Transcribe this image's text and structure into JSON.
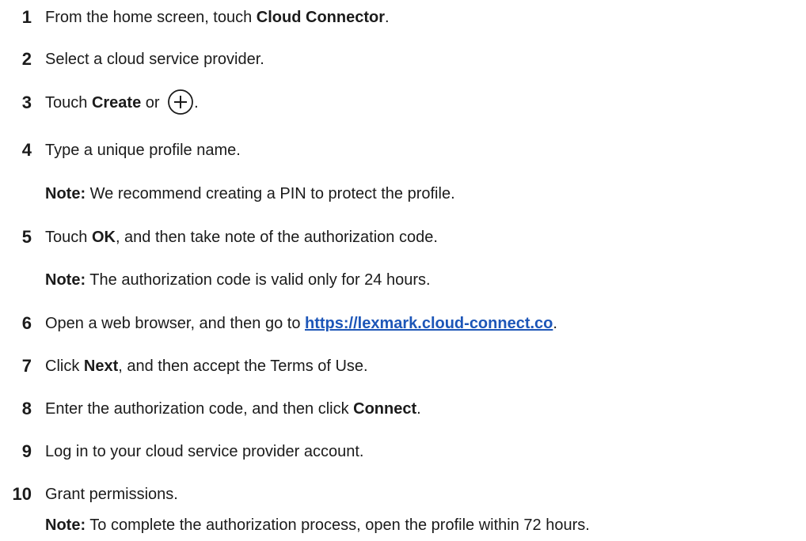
{
  "steps": [
    {
      "num": "1",
      "pre": "From the home screen, touch ",
      "bold": "Cloud Connector",
      "post": "."
    },
    {
      "num": "2",
      "text": "Select a cloud service provider."
    },
    {
      "num": "3",
      "pre": "Touch ",
      "bold": "Create",
      "mid": " or ",
      "post": ".",
      "icon": "plus-circle-icon"
    },
    {
      "num": "4",
      "text": "Type a unique profile name."
    },
    {
      "note": true,
      "label": "Note:",
      "text": " We recommend creating a PIN to protect the profile."
    },
    {
      "num": "5",
      "pre": "Touch ",
      "bold": "OK",
      "post": ", and then take note of the authorization code."
    },
    {
      "note": true,
      "label": "Note:",
      "text": " The authorization code is valid only for 24 hours."
    },
    {
      "num": "6",
      "pre": "Open a web browser, and then go to ",
      "link": "https://lexmark.cloud-connect.co",
      "post": "."
    },
    {
      "num": "7",
      "pre": "Click ",
      "bold": "Next",
      "post": ", and then accept the Terms of Use."
    },
    {
      "num": "8",
      "pre": "Enter the authorization code, and then click ",
      "bold": "Connect",
      "post": "."
    },
    {
      "num": "9",
      "text": "Log in to your cloud service provider account."
    },
    {
      "num": "10",
      "text": "Grant permissions."
    },
    {
      "note": true,
      "label": "Note:",
      "text": " To complete the authorization process, open the profile within 72 hours."
    }
  ],
  "colors": {
    "text": "#1b1b1b",
    "link": "#1d56b8"
  }
}
